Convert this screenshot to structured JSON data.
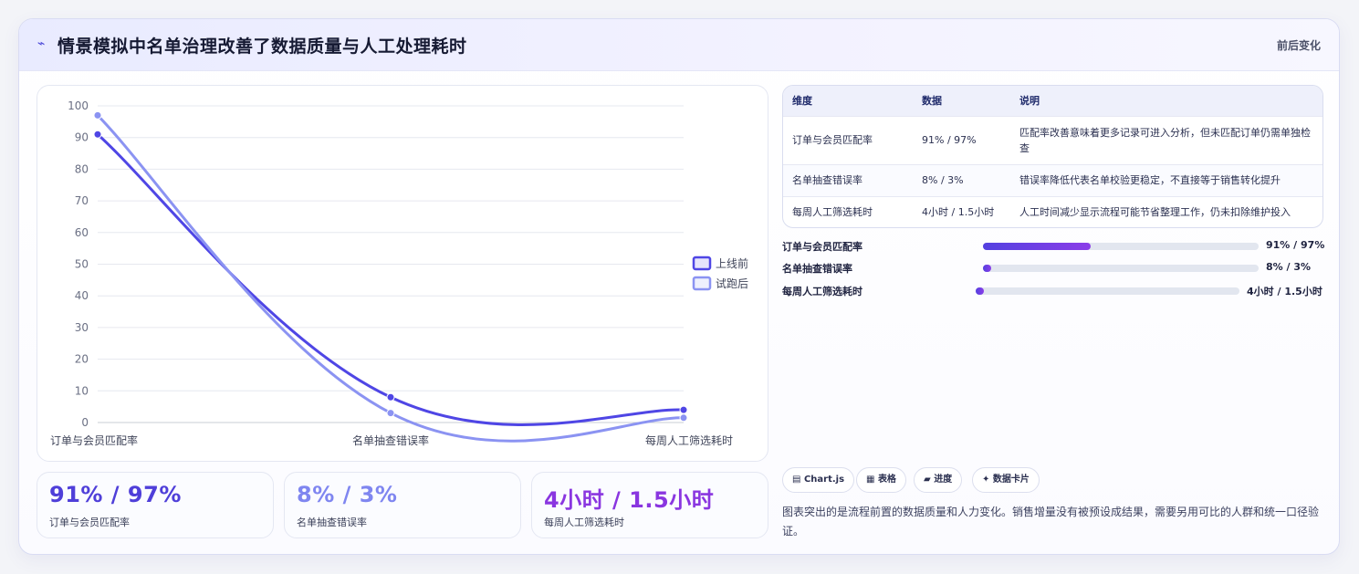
{
  "header": {
    "icon": "trend-icon",
    "title": "情景模拟中名单治理改善了数据质量与人工处理耗时",
    "tag": "前后变化"
  },
  "chart_data": {
    "type": "line",
    "categories": [
      "订单与会员匹配率",
      "名单抽查错误率",
      "每周人工筛选耗时"
    ],
    "series": [
      {
        "name": "上线前",
        "values": [
          91,
          8,
          4
        ],
        "color": "#4f46e5"
      },
      {
        "name": "试跑后",
        "values": [
          97,
          3,
          1.5
        ],
        "color": "#8b93f2"
      }
    ],
    "ylim": [
      0,
      100
    ],
    "yticks": [
      0,
      10,
      20,
      30,
      40,
      50,
      60,
      70,
      80,
      90,
      100
    ],
    "grid": true,
    "legend": "right"
  },
  "kpis": [
    {
      "value": "91% / 97%",
      "label": "订单与会员匹配率",
      "color": "#4f3fd9"
    },
    {
      "value": "8% / 3%",
      "label": "名单抽查错误率",
      "color": "#7f86f0"
    },
    {
      "value": "4小时 / 1.5小时",
      "label": "每周人工筛选耗时",
      "color": "#8a36e0"
    }
  ],
  "table": {
    "headers": [
      "维度",
      "数据",
      "说明"
    ],
    "rows": [
      [
        "订单与会员匹配率",
        "91% / 97%",
        "匹配率改善意味着更多记录可进入分析，但未匹配订单仍需单独检查"
      ],
      [
        "名单抽查错误率",
        "8% / 3%",
        "错误率降低代表名单校验更稳定，不直接等于销售转化提升"
      ],
      [
        "每周人工筛选耗时",
        "4小时 / 1.5小时",
        "人工时间减少显示流程可能节省整理工作，仍未扣除维护投入"
      ]
    ]
  },
  "progress": [
    {
      "label": "订单与会员匹配率",
      "value": "91% / 97%",
      "fill_pct": 39
    },
    {
      "label": "名单抽查错误率",
      "value": "8% / 3%",
      "fill_pct": 3
    },
    {
      "label": "每周人工筛选耗时",
      "value": "4小时 / 1.5小时",
      "fill_pct": 3
    }
  ],
  "pills": [
    {
      "icon": "chart-icon",
      "glyph": "▤",
      "label": "Chart.js"
    },
    {
      "icon": "table-icon",
      "glyph": "▦",
      "label": "表格"
    },
    {
      "icon": "progress-icon",
      "glyph": "▰",
      "label": "进度"
    },
    {
      "icon": "sparkle-icon",
      "glyph": "✦",
      "label": "数据卡片"
    }
  ],
  "note": "图表突出的是流程前置的数据质量和人力变化。销售增量没有被预设成结果，需要另用可比的人群和统一口径验证。"
}
